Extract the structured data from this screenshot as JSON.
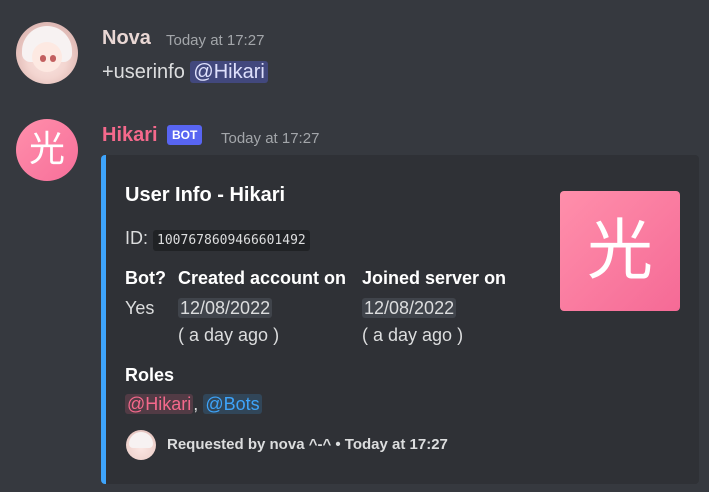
{
  "messages": [
    {
      "author": "Nova",
      "author_color": "#e9d7d4",
      "timestamp": "Today at 17:27",
      "content_prefix": "+userinfo",
      "mention": "@Hikari"
    },
    {
      "author": "Hikari",
      "author_color": "#f5698c",
      "badge": "BOT",
      "timestamp": "Today at 17:27",
      "embed": {
        "accent_color": "#3ea4fb",
        "title": "User Info - Hikari",
        "id_label": "ID:",
        "id_value": "1007678609466601492",
        "thumbnail_glyph": "光",
        "fields": [
          {
            "name": "Bot?",
            "value": "Yes"
          },
          {
            "name": "Created account on",
            "date": "12/08/2022",
            "relative": "( a day ago )"
          },
          {
            "name": "Joined server on",
            "date": "12/08/2022",
            "relative": "( a day ago )"
          }
        ],
        "roles_label": "Roles",
        "roles": [
          "@Hikari",
          "@Bots"
        ],
        "roles_separator": ",",
        "footer_text": "Requested by nova ^-^ • Today at 17:27"
      }
    }
  ],
  "avatar_glyph": "光"
}
